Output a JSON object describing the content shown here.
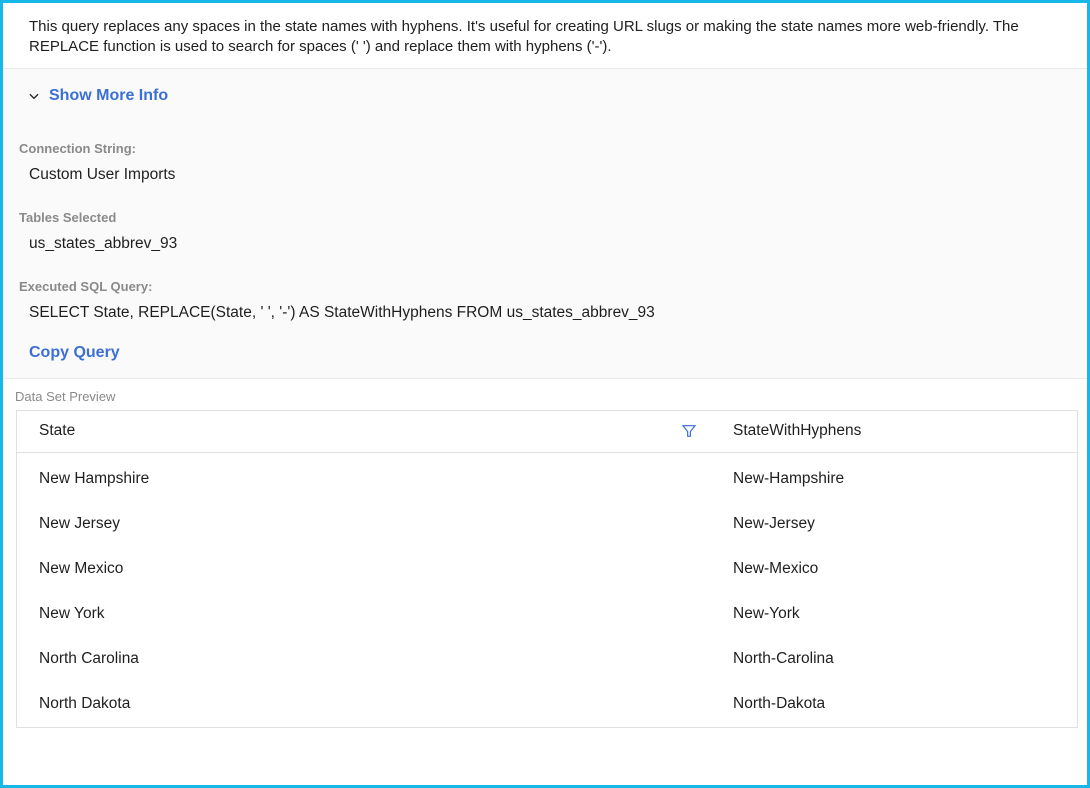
{
  "description": "This query replaces any spaces in the state names with hyphens. It's useful for creating URL slugs or making the state names more web-friendly. The REPLACE function is used to search for spaces (' ') and replace them with hyphens ('-').",
  "toggle": {
    "label": "Show More Info"
  },
  "labels": {
    "connection": "Connection String:",
    "tables": "Tables Selected",
    "sql": "Executed SQL Query:",
    "copy": "Copy Query",
    "preview": "Data Set Preview"
  },
  "values": {
    "connection": "Custom User Imports",
    "tables": "us_states_abbrev_93",
    "sql": "SELECT State, REPLACE(State, ' ', '-') AS StateWithHyphens FROM us_states_abbrev_93"
  },
  "columns": {
    "state": "State",
    "hyph": "StateWithHyphens"
  },
  "rows": [
    {
      "state": "New Hampshire",
      "hyph": "New-Hampshire"
    },
    {
      "state": "New Jersey",
      "hyph": "New-Jersey"
    },
    {
      "state": "New Mexico",
      "hyph": "New-Mexico"
    },
    {
      "state": "New York",
      "hyph": "New-York"
    },
    {
      "state": "North Carolina",
      "hyph": "North-Carolina"
    },
    {
      "state": "North Dakota",
      "hyph": "North-Dakota"
    }
  ]
}
